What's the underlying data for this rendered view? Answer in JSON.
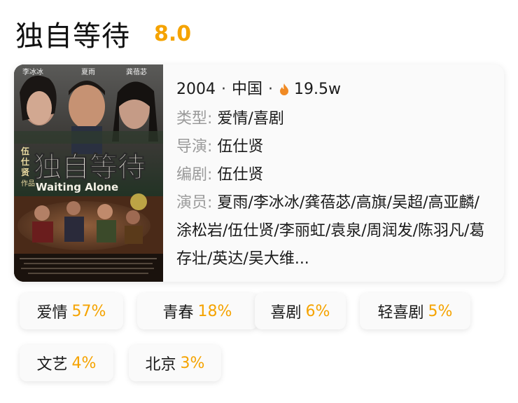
{
  "movie": {
    "title": "独自等待",
    "rating": "8.0",
    "year": "2004",
    "region": "中国",
    "heat": "19.5w",
    "genre_label": "类型:",
    "genre": "爱情/喜剧",
    "director_label": "导演:",
    "director": "伍仕贤",
    "writer_label": "编剧:",
    "writer": "伍仕贤",
    "cast_label": "演员:",
    "cast": "夏雨/李冰冰/龚蓓苾/高旗/吴超/高亚麟/涂松岩/伍仕贤/李丽虹/袁泉/周润发/陈羽凡/葛存壮/英达/吴大维..."
  },
  "poster": {
    "top_names": [
      "李冰冰",
      "夏雨",
      "龚蓓苾"
    ],
    "title_cn": "独自等待",
    "title_en": "Waiting Alone",
    "director_vertical": "伍仕贤作品"
  },
  "tags": [
    {
      "name": "爱情",
      "pct": "57%"
    },
    {
      "name": "青春",
      "pct": "18%"
    },
    {
      "name": "喜剧",
      "pct": "6%"
    },
    {
      "name": "轻喜剧",
      "pct": "5%"
    },
    {
      "name": "文艺",
      "pct": "4%"
    },
    {
      "name": "北京",
      "pct": "3%"
    }
  ],
  "colors": {
    "accent": "#f5a300",
    "label": "#9a9a9a",
    "card": "#fafafa"
  },
  "icons": {
    "heat": "flame-icon"
  }
}
